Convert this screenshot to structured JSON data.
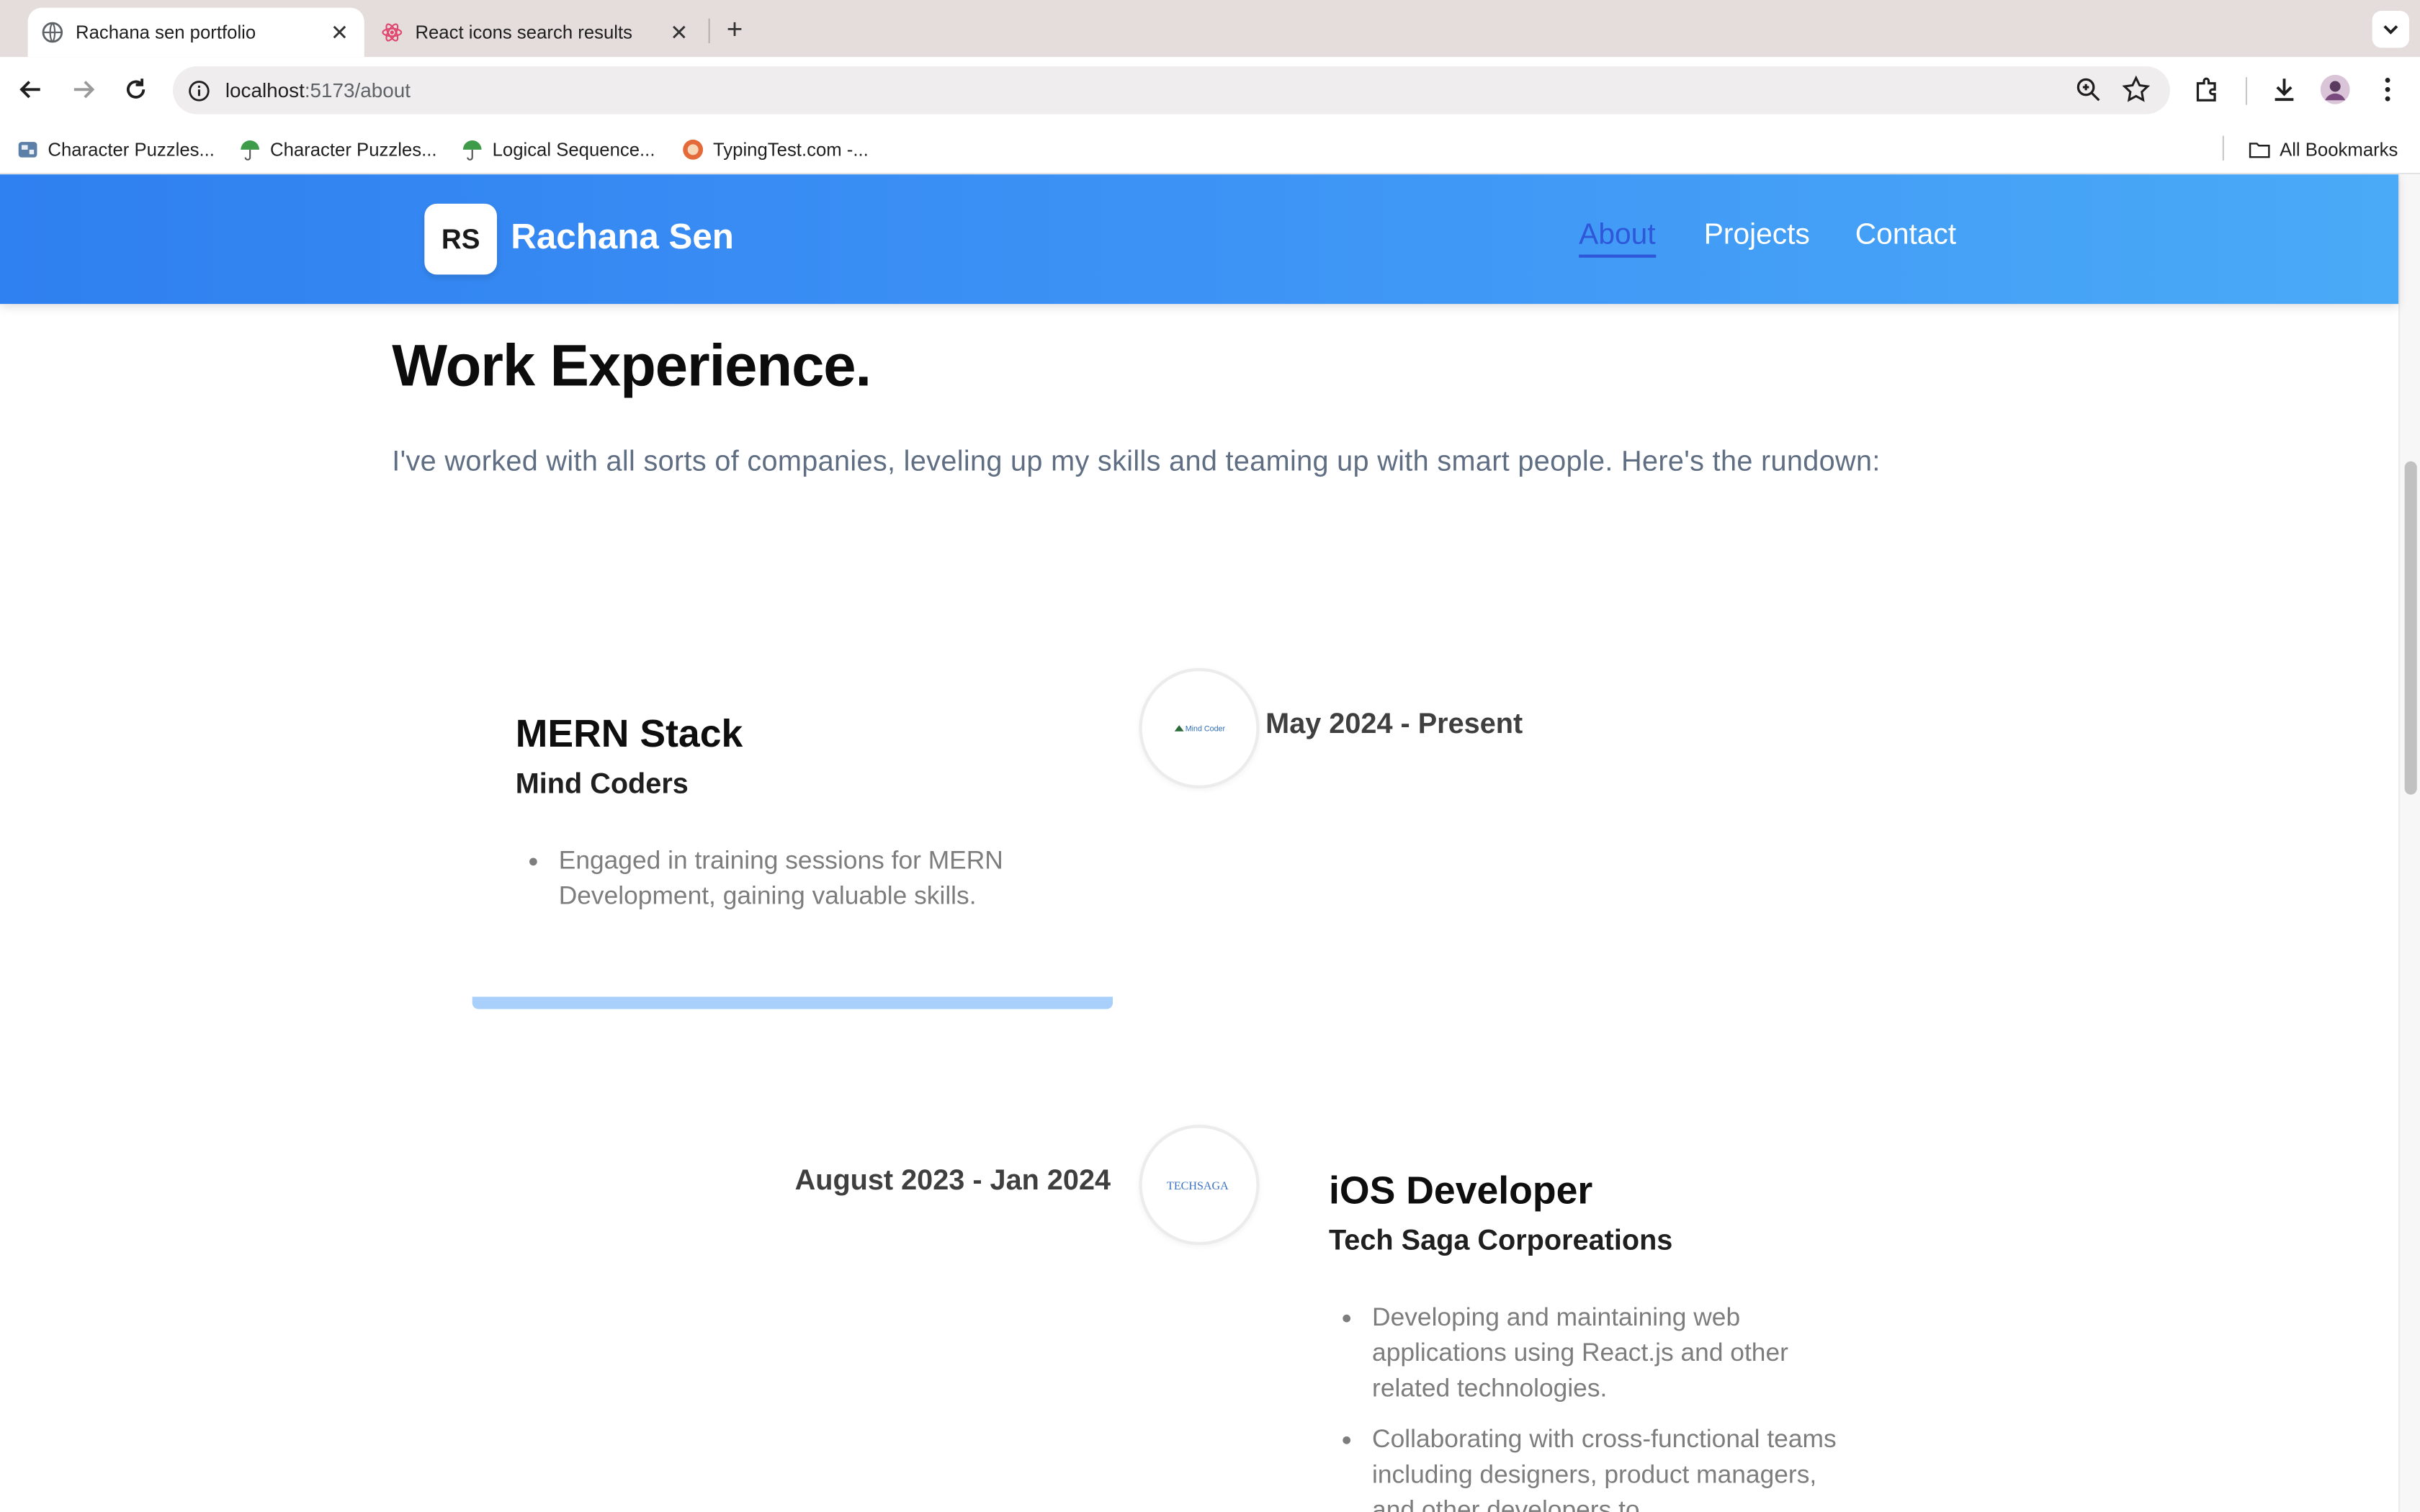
{
  "browser": {
    "tabs": [
      {
        "title": "Rachana sen portfolio",
        "active": true
      },
      {
        "title": "React icons search results",
        "active": false
      }
    ],
    "url": {
      "host": "localhost",
      "path": ":5173/about"
    },
    "bookmarks": [
      {
        "label": "Character Puzzles..."
      },
      {
        "label": "Character Puzzles..."
      },
      {
        "label": "Logical Sequence..."
      },
      {
        "label": "TypingTest.com -..."
      }
    ],
    "all_bookmarks_label": "All Bookmarks"
  },
  "site": {
    "logo_initials": "RS",
    "logo_name": "Rachana Sen",
    "nav": [
      {
        "label": "About",
        "active": true
      },
      {
        "label": "Projects",
        "active": false
      },
      {
        "label": "Contact",
        "active": false
      }
    ]
  },
  "section": {
    "heading": "Work Experience.",
    "intro": "I've worked with all sorts of companies, leveling up my skills and teaming up with smart people. Here's the rundown:"
  },
  "experiences": [
    {
      "title": "MERN Stack",
      "company": "Mind Coders",
      "date": "May 2024 - Present",
      "points": [
        "Engaged in training sessions for MERN Development, gaining valuable skills."
      ]
    },
    {
      "title": "iOS Developer",
      "company": "Tech Saga Corporeations",
      "date": "August 2023 - Jan 2024",
      "points": [
        "Developing and maintaining web applications using React.js and other related technologies.",
        "Collaborating with cross-functional teams including designers, product managers, and other developers to"
      ]
    }
  ],
  "colors": {
    "navbar_start": "#2f80f0",
    "navbar_end": "#4aaaf7",
    "nav_active": "#2e57d9",
    "card_accent": "#a8d0fa"
  }
}
